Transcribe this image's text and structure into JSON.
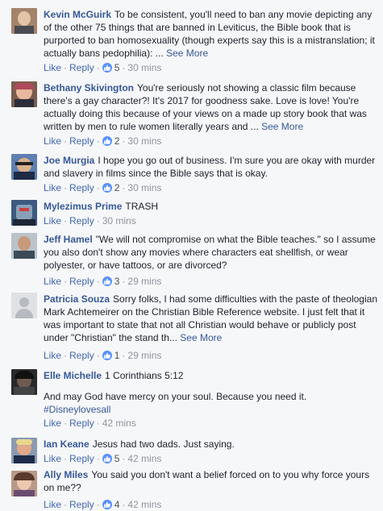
{
  "labels": {
    "like": "Like",
    "reply": "Reply",
    "see_more": "See More",
    "dot": "·"
  },
  "colors": {
    "link": "#365899",
    "action": "#4267b2",
    "like_badge": "#5890ff",
    "meta": "#90949c"
  },
  "comments": [
    {
      "author": "Kevin McGuirk",
      "text": "To be consistent, you'll need to ban any movie depicting any of the other 75 things that are banned in Leviticus, the Bible book that is purported to ban homosexuality (though experts say this is a mistranslation; it actually bans pedophilia): ...",
      "see_more": true,
      "likes": "5",
      "time": "30 mins"
    },
    {
      "author": "Bethany Skivington",
      "text": "You're seriously not showing a classic film because there's a gay character?! It's 2017 for goodness sake. Love is love! You're actually doing this because of your views on a made up story book that was written by men to rule women literally years and ...",
      "see_more": true,
      "likes": "2",
      "time": "30 mins"
    },
    {
      "author": "Joe Murgia",
      "text": "I hope you go out of business. I'm sure you are okay with murder and slavery in films since the Bible says that is okay.",
      "see_more": false,
      "likes": "2",
      "time": "30 mins"
    },
    {
      "author": "Mylezimus Prime",
      "text": "TRASH",
      "see_more": false,
      "likes": "",
      "time": "30 mins"
    },
    {
      "author": "Jeff Hamel",
      "text": "\"We will not compromise on what the Bible teaches.\" so I assume you also don't show any movies where characters eat shellfish, or wear polyester, or have tattoos, or are divorced?",
      "see_more": false,
      "likes": "3",
      "time": "29 mins"
    },
    {
      "author": "Patricia Souza",
      "text": "Sorry folks, I had some difficulties with the paste of theologian Mark Achtemeirer on the Christian Bible Reference website. I just felt that it was important to state that not all Christian would behave or publicly post under \"Christian\" the stand th...",
      "see_more": true,
      "likes": "1",
      "time": "29 mins"
    },
    {
      "author": "Elle Michelle",
      "text": "1 Corinthians 5:12",
      "text2": "And may God have mercy on your soul. Because you need it.",
      "hashtag": "#Disneylovesall",
      "see_more": false,
      "likes": "",
      "time": "42 mins"
    },
    {
      "author": "Ian Keane",
      "text": "Jesus had two dads. Just saying.",
      "see_more": false,
      "likes": "5",
      "time": "42 mins"
    },
    {
      "author": "Ally Miles",
      "text": "You said you don't want a belief forced on to you why force yours on me??",
      "see_more": false,
      "likes": "4",
      "time": "42 mins"
    }
  ]
}
